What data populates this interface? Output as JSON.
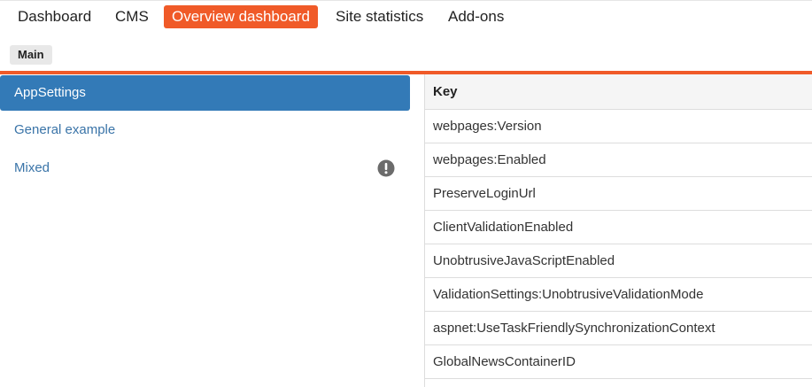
{
  "top_nav": {
    "items": [
      {
        "label": "Dashboard",
        "active": false
      },
      {
        "label": "CMS",
        "active": false
      },
      {
        "label": "Overview dashboard",
        "active": true
      },
      {
        "label": "Site statistics",
        "active": false
      },
      {
        "label": "Add-ons",
        "active": false
      }
    ]
  },
  "sub_nav": {
    "tabs": [
      {
        "label": "Main",
        "active": true
      }
    ]
  },
  "sidebar": {
    "items": [
      {
        "label": "AppSettings",
        "active": true,
        "icon": null
      },
      {
        "label": "General example",
        "active": false,
        "icon": null
      },
      {
        "label": "Mixed",
        "active": false,
        "icon": "warning-icon"
      }
    ]
  },
  "table": {
    "header": "Key",
    "rows": [
      "webpages:Version",
      "webpages:Enabled",
      "PreserveLoginUrl",
      "ClientValidationEnabled",
      "UnobtrusiveJavaScriptEnabled",
      "ValidationSettings:UnobtrusiveValidationMode",
      "aspnet:UseTaskFriendlySynchronizationContext",
      "GlobalNewsContainerID"
    ]
  },
  "colors": {
    "accent": "#f05a28",
    "selected": "#337ab7",
    "link": "#3a74a8",
    "warning_icon": "#6b6b6b"
  }
}
